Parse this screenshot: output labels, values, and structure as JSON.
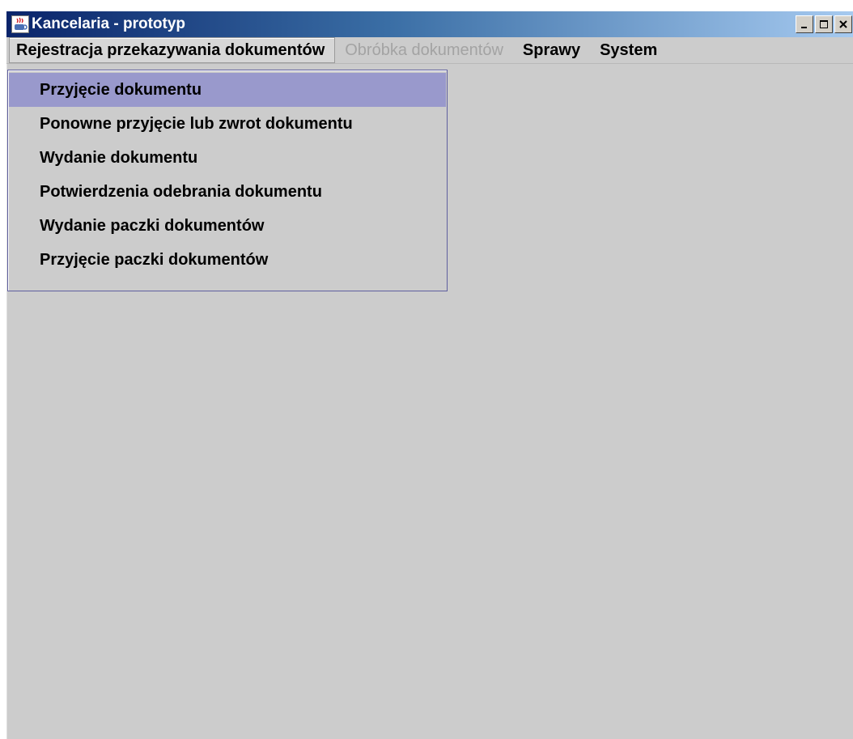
{
  "window": {
    "title": "Kancelaria - prototyp",
    "icon": "java-app-icon",
    "controls": [
      "minimize-icon",
      "maximize-icon",
      "close-icon"
    ]
  },
  "menubar": {
    "items": [
      {
        "label": "Rejestracja przekazywania dokumentów",
        "state": "open"
      },
      {
        "label": "Obróbka dokumentów",
        "state": "disabled"
      },
      {
        "label": "Sprawy",
        "state": "normal"
      },
      {
        "label": "System",
        "state": "normal"
      }
    ]
  },
  "dropdown": {
    "items": [
      {
        "label": "Przyjęcie dokumentu",
        "selected": true
      },
      {
        "label": "Ponowne przyjęcie lub zwrot dokumentu",
        "selected": false
      },
      {
        "label": "Wydanie dokumentu",
        "selected": false
      },
      {
        "label": "Potwierdzenia odebrania dokumentu",
        "selected": false
      },
      {
        "label": "Wydanie paczki dokumentów",
        "selected": false
      },
      {
        "label": "Przyjęcie paczki dokumentów",
        "selected": false
      }
    ]
  },
  "colors": {
    "title_gradient_start": "#0a246a",
    "title_gradient_end": "#a6caf0",
    "background": "#cccccc",
    "selection": "#9999cc",
    "disabled_text": "#a3a3a3"
  }
}
